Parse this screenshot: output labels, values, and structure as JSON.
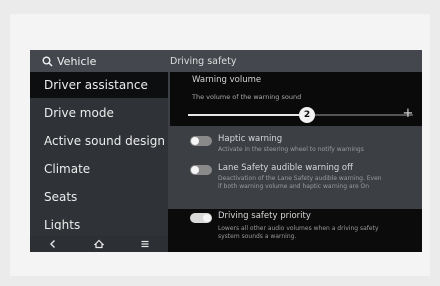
{
  "header": {
    "left_title": "Vehicle",
    "right_title": "Driving safety"
  },
  "sidebar": {
    "items": [
      {
        "label": "Driver assistance"
      },
      {
        "label": "Drive mode"
      },
      {
        "label": "Active sound design"
      },
      {
        "label": "Climate"
      },
      {
        "label": "Seats"
      },
      {
        "label": "Lights"
      }
    ]
  },
  "nav": {
    "back_icon": "back-icon",
    "home_icon": "home-icon",
    "menu_icon": "menu-icon"
  },
  "warning_volume": {
    "title": "Warning volume",
    "description": "The volume of the warning sound",
    "value": "2",
    "level_fraction": 0.55,
    "plus_label": "+"
  },
  "settings": {
    "haptic": {
      "title": "Haptic warning",
      "description": "Activate in the steering wheel to notify warnings",
      "enabled": false
    },
    "lane_safety": {
      "title": "Lane Safety audible warning off",
      "description_line1": "Deactivation of the Lane Safety audible warning. Even",
      "description_line2": "if both warning volume and haptic warning are On",
      "enabled": false
    },
    "priority": {
      "title": "Driving safety priority",
      "description_line1": "Lowers all other audio volumes when a driving safety",
      "description_line2": "system sounds a warning.",
      "enabled": true
    }
  },
  "colors": {
    "toggle_on": "#d9d9d9",
    "toggle_off": "#8a8a8a",
    "popup_bg": "#0a0a0b"
  }
}
